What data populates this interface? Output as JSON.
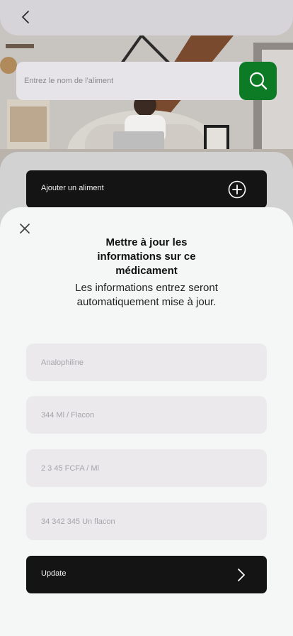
{
  "header": {
    "back_icon": "chevron-left-icon"
  },
  "search": {
    "placeholder": "Entrez le nom de l'aliment",
    "button_icon": "search-icon",
    "button_color": "#0d7b26"
  },
  "add_food": {
    "label": "Ajouter un aliment",
    "icon": "plus-circle-icon"
  },
  "sheet": {
    "close_icon": "close-icon",
    "title": "Mettre à jour les informations sur ce médicament",
    "subtitle": "Les informations entrez seront automatiquement mise à jour.",
    "fields": [
      {
        "placeholder": "Analophiline"
      },
      {
        "placeholder": "344 Ml / Flacon"
      },
      {
        "placeholder": "2 3 45 FCFA / Ml"
      },
      {
        "placeholder": "34 342 345 Un flacon"
      }
    ],
    "update_label": "Update",
    "update_icon": "chevron-right-icon"
  },
  "colors": {
    "dark_button": "#141414",
    "field_bg": "#ebe9ec",
    "sheet_bg": "#f4f7f6"
  }
}
